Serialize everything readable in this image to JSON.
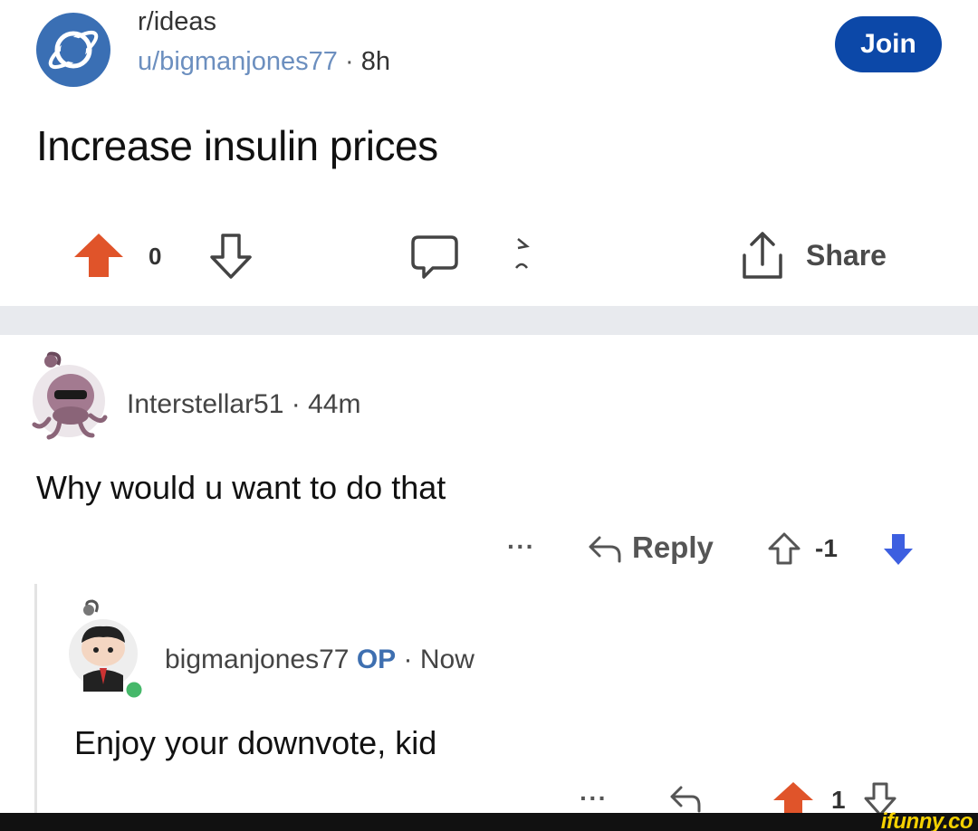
{
  "post": {
    "subreddit": "r/ideas",
    "author": "u/bigmanjones77",
    "separator": "·",
    "time": "8h",
    "join_label": "Join",
    "title": "Increase insulin prices",
    "vote_count": "0",
    "share_label": "Share"
  },
  "comments": [
    {
      "user": "Interstellar51",
      "separator": "·",
      "time": "44m",
      "body": "Why would u want to do that",
      "more": "···",
      "reply_label": "Reply",
      "score": "-1",
      "vote_state": "downvoted"
    },
    {
      "user": "bigmanjones77",
      "op_badge": "OP",
      "separator": "·",
      "time": "Now",
      "body": "Enjoy your downvote, kid",
      "more": "···",
      "score": "1",
      "vote_state": "upvoted"
    }
  ],
  "watermark": "ifunny.co",
  "colors": {
    "join_button": "#0c48a8",
    "upvote": "#e0542a",
    "downvote": "#3d5fe0",
    "op_badge": "#3e6fb0",
    "author_link": "#6c8fbf",
    "divider": "#e8eaee"
  },
  "icons": [
    "subreddit-planet-icon",
    "upvote-arrow-icon",
    "downvote-arrow-icon",
    "comment-bubble-icon",
    "award-icon",
    "share-icon",
    "reply-arrow-icon",
    "more-dots-icon"
  ]
}
